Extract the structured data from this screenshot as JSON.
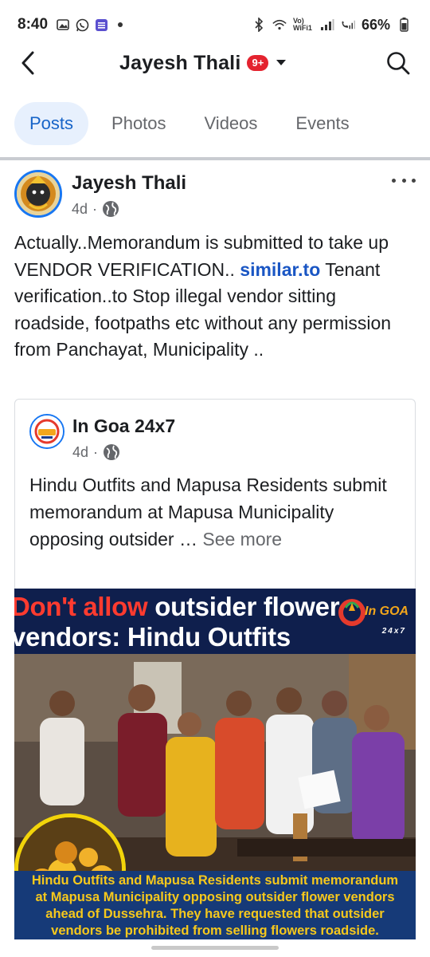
{
  "status_bar": {
    "time": "8:40",
    "left_icons": [
      "gallery-icon",
      "whatsapp-icon",
      "list-app-icon",
      "dot-icon"
    ],
    "right_icons": [
      "bluetooth-icon",
      "wifi-icon",
      "signal-icon",
      "call-signal-icon"
    ],
    "wifi_label": "Vo) WiFi1",
    "battery": "66%"
  },
  "header": {
    "title": "Jayesh Thali",
    "notification_badge": "9+"
  },
  "tabs": [
    {
      "label": "Posts",
      "active": true
    },
    {
      "label": "Photos",
      "active": false
    },
    {
      "label": "Videos",
      "active": false
    },
    {
      "label": "Events",
      "active": false
    }
  ],
  "post": {
    "author": "Jayesh Thali",
    "time": "4d",
    "separator": "·",
    "text_before_link": "Actually..Memorandum is submitted to take  up VENDOR VERIFICATION.. ",
    "link": "similar.to",
    "text_after_link": " Tenant verification..to Stop illegal vendor sitting roadside, footpaths etc without any permission from Panchayat, Municipality .."
  },
  "shared": {
    "author": "In Goa 24x7",
    "time": "4d",
    "separator": "·",
    "text": "Hindu Outfits and Mapusa Residents submit memorandum at Mapusa Municipality opposing outsider … ",
    "see_more": "See more"
  },
  "news_image": {
    "headline_red": "Don't allow",
    "headline_line1_rest": " outsider flower",
    "headline_line2": "vendors: Hindu Outfits",
    "logo_text": "In GOA",
    "logo_sub": "24x7",
    "caption": "Hindu Outfits and Mapusa Residents submit memorandum\nat Mapusa Municipality opposing outsider flower vendors\nahead of Dussehra. They have requested that outsider\nvendors be prohibited from selling flowers roadside."
  },
  "colors": {
    "accent": "#1877f2",
    "active_tab_bg": "#e7f0fd",
    "active_tab_text": "#1764c8",
    "badge": "#e4232f",
    "headline_red": "#ff3b2f",
    "caption_yellow": "#f6c81c",
    "caption_band": "#163a78"
  }
}
